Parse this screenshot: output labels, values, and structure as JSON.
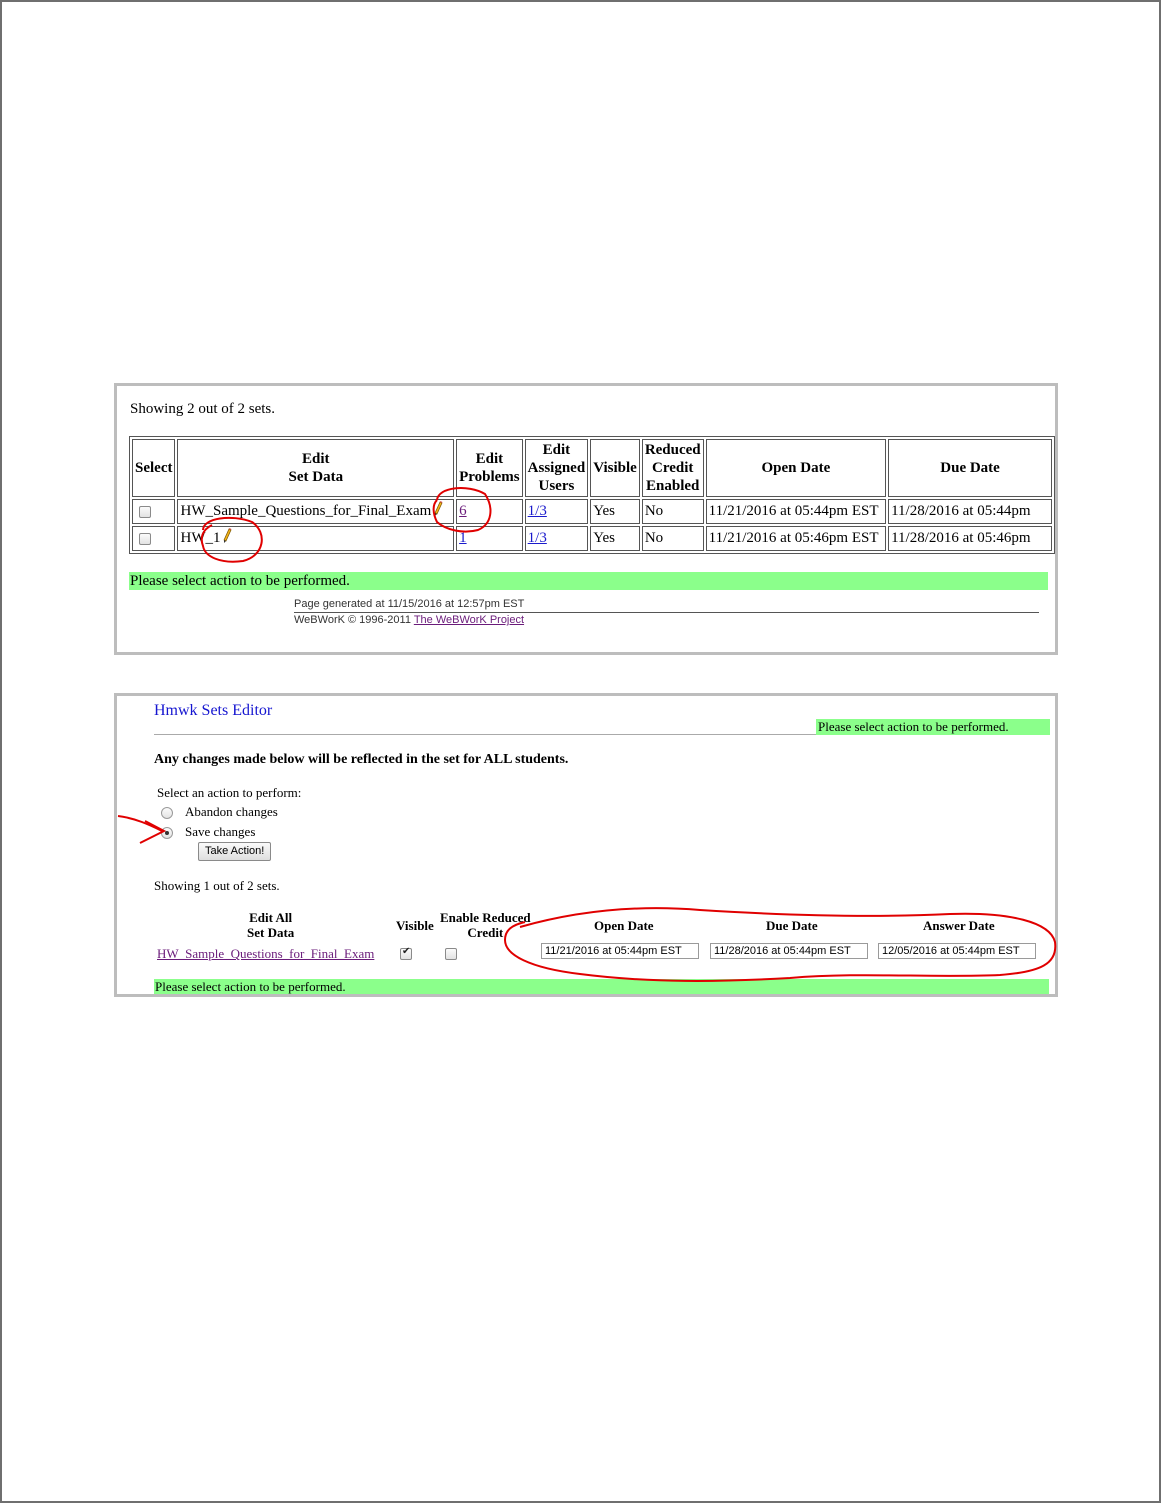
{
  "panel1": {
    "showing_text": "Showing 2 out of 2 sets.",
    "columns": {
      "select": "Select",
      "edit_set_1": "Edit",
      "edit_set_2": "Set Data",
      "edit_problems_1": "Edit",
      "edit_problems_2": "Problems",
      "edit_users_1": "Edit",
      "edit_users_2": "Assigned",
      "edit_users_3": "Users",
      "visible": "Visible",
      "reduced_1": "Reduced",
      "reduced_2": "Credit",
      "reduced_3": "Enabled",
      "open_date": "Open Date",
      "due_date": "Due Date"
    },
    "rows": [
      {
        "set": "HW_Sample_Questions_for_Final_Exam",
        "problems": "6",
        "users": "1/3",
        "visible": "Yes",
        "reduced": "No",
        "open": "11/21/2016 at 05:44pm EST",
        "due": "11/28/2016 at 05:44pm"
      },
      {
        "set": "HW_1",
        "problems": "1",
        "users": "1/3",
        "visible": "Yes",
        "reduced": "No",
        "open": "11/21/2016 at 05:46pm EST",
        "due": "11/28/2016 at 05:46pm"
      }
    ],
    "status_message": "Please select action to be performed.",
    "footer_generated": "Page generated at 11/15/2016 at 12:57pm EST",
    "footer_copyright": "WeBWorK © 1996-2011",
    "footer_link": "The WeBWorK Project"
  },
  "panel2": {
    "title": "Hmwk Sets Editor",
    "status_message": "Please select action to be performed.",
    "warning": "Any changes made below will be reflected in the set for ALL students.",
    "action_label": "Select an action to perform:",
    "options": [
      "Abandon changes",
      "Save changes"
    ],
    "selected_option": "Save changes",
    "take_action_label": "Take Action!",
    "showing_text": "Showing 1 out of 2 sets.",
    "headers": {
      "edit_all_1": "Edit All",
      "edit_all_2": "Set Data",
      "visible": "Visible",
      "reduced_1": "Enable Reduced",
      "reduced_2": "Credit",
      "open_date": "Open Date",
      "due_date": "Due Date",
      "answer_date": "Answer Date"
    },
    "row": {
      "set": "HW_Sample_Questions_for_Final_Exam",
      "visible_checked": true,
      "reduced_checked": false,
      "open_date": "11/21/2016 at 05:44pm EST",
      "due_date": "11/28/2016 at 05:44pm EST",
      "answer_date": "12/05/2016 at 05:44pm EST"
    },
    "bottom_status": "Please select action to be performed."
  },
  "colors": {
    "status_green": "#8bff8b",
    "annotation_red": "#e00000",
    "link_visited": "#6a1b7a",
    "link_blue": "#1a1acc"
  }
}
